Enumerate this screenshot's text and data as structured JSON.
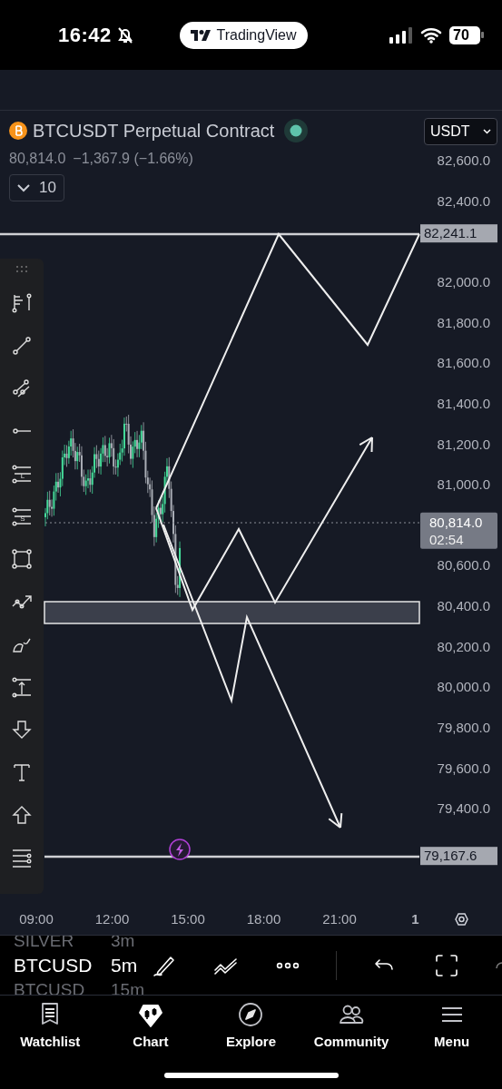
{
  "status_bar": {
    "time": "16:42",
    "app_pill": "TradingView",
    "battery": "70"
  },
  "chart": {
    "title": "BTCUSDT Perpetual Contract",
    "last_price": "80,814.0",
    "change": "−1,367.9 (−1.66%)",
    "indicators_count": "10",
    "currency": "USDT",
    "price_axis": [
      "82,600.0",
      "82,400.0",
      "82,000.0",
      "81,800.0",
      "81,600.0",
      "81,400.0",
      "81,200.0",
      "81,000.0",
      "80,600.0",
      "80,400.0",
      "80,200.0",
      "80,000.0",
      "79,800.0",
      "79,600.0",
      "79,400.0"
    ],
    "price_badges": [
      {
        "kind": "level",
        "price": "82,241.1"
      },
      {
        "kind": "last",
        "price": "80,814.0",
        "countdown": "02:54"
      },
      {
        "kind": "level",
        "price": "79,167.6"
      }
    ],
    "time_axis": [
      "09:00",
      "12:00",
      "15:00",
      "18:00",
      "21:00",
      "1"
    ]
  },
  "drawing_tools": [
    {
      "kind": "grip"
    },
    {
      "kind": "fib"
    },
    {
      "kind": "trend"
    },
    {
      "kind": "channel"
    },
    {
      "kind": "ray"
    },
    {
      "kind": "position",
      "label": "L"
    },
    {
      "kind": "position",
      "label": "S"
    },
    {
      "kind": "rect"
    },
    {
      "kind": "path"
    },
    {
      "kind": "brush"
    },
    {
      "kind": "measure"
    },
    {
      "kind": "arrow_down"
    },
    {
      "kind": "text"
    },
    {
      "kind": "arrow_up"
    },
    {
      "kind": "levels"
    }
  ],
  "symbol_picker": [
    {
      "symbol": "SILVER",
      "interval": "3m",
      "selected": false
    },
    {
      "symbol": "BTCUSD",
      "interval": "5m",
      "selected": true
    },
    {
      "symbol": "BTCUSD",
      "interval": "15m",
      "selected": false
    }
  ],
  "tabs": [
    {
      "kind": "watchlist",
      "label": "Watchlist",
      "selected": false
    },
    {
      "kind": "chart",
      "label": "Chart",
      "selected": true
    },
    {
      "kind": "explore",
      "label": "Explore",
      "selected": false
    },
    {
      "kind": "community",
      "label": "Community",
      "selected": false
    },
    {
      "kind": "menu",
      "label": "Menu",
      "selected": false
    }
  ]
}
